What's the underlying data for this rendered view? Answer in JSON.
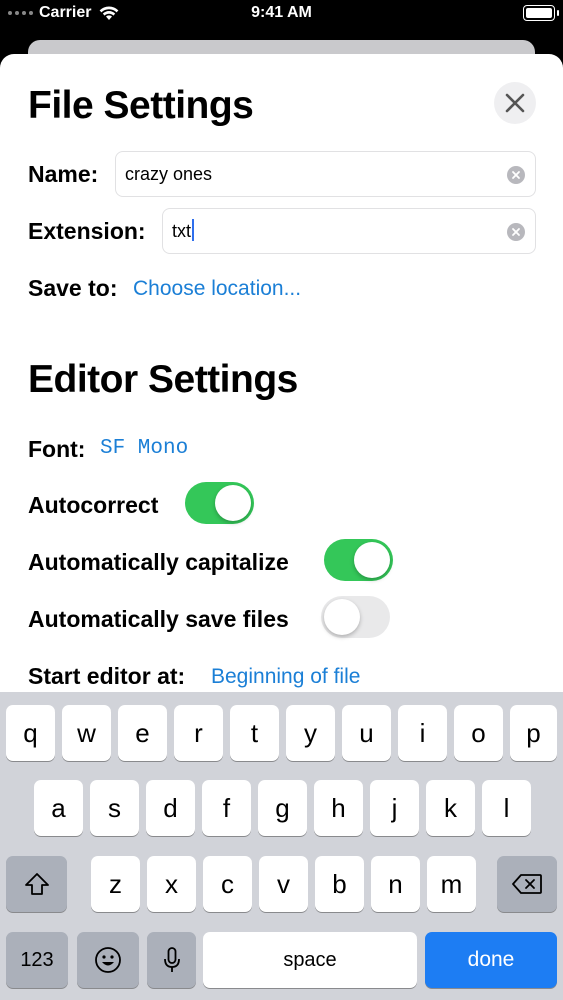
{
  "status_bar": {
    "carrier": "Carrier",
    "time": "9:41 AM"
  },
  "file_settings": {
    "title": "File Settings",
    "name_label": "Name:",
    "name_value": "crazy ones",
    "extension_label": "Extension:",
    "extension_value": "txt",
    "save_to_label": "Save to:",
    "save_to_link": "Choose location..."
  },
  "editor_settings": {
    "title": "Editor Settings",
    "font_label": "Font:",
    "font_value": "SF Mono",
    "autocorrect_label": "Autocorrect",
    "autocorrect_on": true,
    "capitalize_label": "Automatically capitalize",
    "capitalize_on": true,
    "autosave_label": "Automatically save files",
    "autosave_on": false,
    "start_label": "Start editor at:",
    "start_value": "Beginning of file"
  },
  "keyboard": {
    "row1": [
      "q",
      "w",
      "e",
      "r",
      "t",
      "y",
      "u",
      "i",
      "o",
      "p"
    ],
    "row2": [
      "a",
      "s",
      "d",
      "f",
      "g",
      "h",
      "j",
      "k",
      "l"
    ],
    "row3": [
      "z",
      "x",
      "c",
      "v",
      "b",
      "n",
      "m"
    ],
    "numbers_label": "123",
    "space_label": "space",
    "done_label": "done"
  },
  "colors": {
    "accent": "#1b7fd6",
    "toggle_on": "#34c759",
    "done_key": "#1d7df3"
  },
  "icons": [
    "wifi-icon",
    "battery-icon",
    "close-icon",
    "clear-text-icon",
    "shift-icon",
    "delete-icon",
    "emoji-icon",
    "microphone-icon"
  ]
}
